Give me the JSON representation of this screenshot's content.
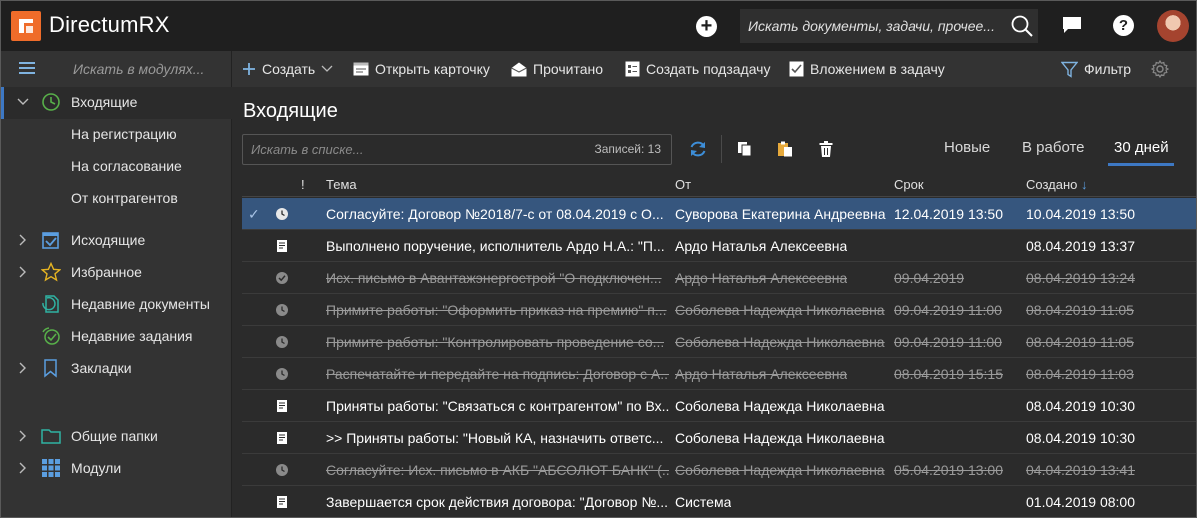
{
  "app": {
    "brand": "DirectumRX",
    "global_search_placeholder": "Искать документы, задачи, прочее..."
  },
  "sidebar": {
    "search_placeholder": "Искать в модулях...",
    "items": [
      {
        "label": "Входящие",
        "icon": "clock-icon"
      },
      {
        "label": "На регистрацию"
      },
      {
        "label": "На согласование"
      },
      {
        "label": "От контрагентов"
      },
      {
        "label": "Исходящие",
        "icon": "checkbox-icon"
      },
      {
        "label": "Избранное",
        "icon": "star-icon"
      },
      {
        "label": "Недавние документы",
        "icon": "recent-doc-icon"
      },
      {
        "label": "Недавние задания",
        "icon": "recent-task-icon"
      },
      {
        "label": "Закладки",
        "icon": "bookmark-icon"
      },
      {
        "label": "Общие папки",
        "icon": "folder-icon"
      },
      {
        "label": "Модули",
        "icon": "grid-icon"
      }
    ]
  },
  "toolbar": {
    "create": "Создать",
    "open_card": "Открыть карточку",
    "read": "Прочитано",
    "create_subtask": "Создать подзадачу",
    "attach_to_task": "Вложением в задачу",
    "filter": "Фильтр"
  },
  "main": {
    "title": "Входящие",
    "list_search_placeholder": "Искать в списке...",
    "records_count": "Записей: 13",
    "tabs": [
      {
        "label": "Новые"
      },
      {
        "label": "В работе"
      },
      {
        "label": "30 дней"
      }
    ],
    "columns": {
      "importance": "!",
      "subject": "Тема",
      "from": "От",
      "deadline": "Срок",
      "created": "Создано"
    },
    "rows": [
      {
        "subject": "Согласуйте: Договор №2018/7-с от 08.04.2019 с О...",
        "from": "Суворова Екатерина Андреевна",
        "deadline": "12.04.2019 13:50",
        "created": "10.04.2019 13:50",
        "state": "clock",
        "done": false,
        "selected": true
      },
      {
        "subject": "Выполнено поручение, исполнитель Ардо Н.А.: \"П...",
        "from": "Ардо Наталья Алексеевна",
        "deadline": "",
        "created": "08.04.2019 13:37",
        "state": "notice",
        "done": false,
        "selected": false
      },
      {
        "subject": "Исх. письмо в Авантажэнергострой \"О подключен...",
        "from": "Ардо Наталья Алексеевна",
        "deadline": "09.04.2019",
        "created": "08.04.2019 13:24",
        "state": "completed",
        "done": true,
        "selected": false
      },
      {
        "subject": "Примите работы: \"Оформить приказ на премию\" п...",
        "from": "Соболева Надежда Николаевна",
        "deadline": "09.04.2019 11:00",
        "created": "08.04.2019 11:05",
        "state": "clock",
        "done": true,
        "selected": false
      },
      {
        "subject": "Примите работы: \"Контролировать проведение со...",
        "from": "Соболева Надежда Николаевна",
        "deadline": "09.04.2019 11:00",
        "created": "08.04.2019 11:05",
        "state": "clock",
        "done": true,
        "selected": false
      },
      {
        "subject": "Распечатайте и передайте на подпись: Договор с А...",
        "from": "Ардо Наталья Алексеевна",
        "deadline": "08.04.2019 15:15",
        "created": "08.04.2019 11:03",
        "state": "clock",
        "done": true,
        "selected": false
      },
      {
        "subject": "Приняты работы: \"Связаться с контрагентом\" по Вх...",
        "from": "Соболева Надежда Николаевна",
        "deadline": "",
        "created": "08.04.2019 10:30",
        "state": "notice",
        "done": false,
        "selected": false
      },
      {
        "subject": ">> Приняты работы: \"Новый КА, назначить ответс...",
        "from": "Соболева Надежда Николаевна",
        "deadline": "",
        "created": "08.04.2019 10:30",
        "state": "notice",
        "done": false,
        "selected": false
      },
      {
        "subject": "Согласуйте: Исх. письмо в АКБ \"АБСОЛЮТ БАНК\" (...",
        "from": "Соболева Надежда Николаевна",
        "deadline": "05.04.2019 13:00",
        "created": "04.04.2019 13:41",
        "state": "clock",
        "done": true,
        "selected": false
      },
      {
        "subject": "Завершается срок действия договора: \"Договор №...",
        "from": "Система",
        "deadline": "",
        "created": "01.04.2019 08:00",
        "state": "notice",
        "done": false,
        "selected": false
      }
    ]
  },
  "colors": {
    "accent": "#3d78c4",
    "selected_row": "#36567e",
    "logo": "#ef6c2a",
    "topbar": "#1f1f1f",
    "sidebar": "#333333"
  }
}
